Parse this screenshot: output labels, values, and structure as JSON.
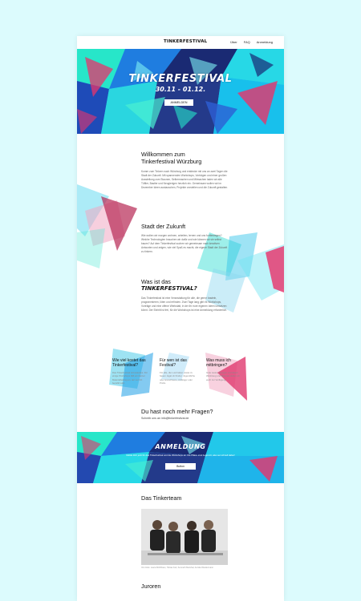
{
  "header": {
    "logo": "TINKERFESTIVAL",
    "nav": [
      "Über",
      "FAQ",
      "Anmeldung"
    ]
  },
  "hero": {
    "title": "TINKERFESTIVAL",
    "date": "30.11 - 01.12.",
    "button": "ANMELDEN"
  },
  "sections": {
    "welcome": {
      "title_line1": "Willkommen zum",
      "title_line2": "Tinkerfestival Würzburg",
      "text": "Komm zum Tinkern nach Würzburg und entdecke mit uns an zwei Tagen die Stadt der Zukunft. Mit spannenden Workshops, Vorträgen und einer großen Ausstellung zum Staunen, Selbermachen und Mitmachen laden wir alle Tüftler, Bastler und Neugierigen herzlich ein. Gemeinsam wollen wir im Dezember Ideen austauschen, Projekte vorstellen und die Zukunft gestalten."
    },
    "city": {
      "title": "Stadt der Zukunft",
      "text": "Wie wollen wir morgen wohnen, arbeiten, lernen und uns fortbewegen? Welche Technologien brauchen wir dafür und wie können wir sie selbst bauen? Auf dem Tinkerfestival suchen wir gemeinsam nach kreativen Antworten und zeigen, wie viel Spaß es macht, die eigene Stadt der Zukunft zu tinkern."
    },
    "what": {
      "title_line1": "Was ist das",
      "title_line2": "TINKERFESTIVAL?",
      "text": "Das Tinkerfestival ist eine Veranstaltung für alle, die gerne basteln, programmieren, löten und erfinden. Zwei Tage lang gibt es Workshops, Vorträge und eine offene Werkstatt, in der ihr eure eigenen Ideen umsetzen könnt. Der Eintritt ist frei, für die Workshops ist eine Anmeldung erforderlich."
    },
    "columns": [
      {
        "title": "Wie viel kostet das Tinkerfestival?",
        "text": "Das Tinkerfestival ist kostenlos. Für einige Workshops fällt ein kleiner Materialbeitrag an, der vor Ort bezahlt wird."
      },
      {
        "title": "Für wen ist das Festival?",
        "text": "Für alle, die Lust haben etwas zu bauen. Egal ob Kinder, Jugendliche oder Erwachsene, Anfänger oder Profis."
      },
      {
        "title": "Was muss ich mitbringen?",
        "text": "Gute Laune, Neugier und Ideen! Werkzeug und Material stellen wir euch zur Verfügung."
      }
    ],
    "questions": {
      "title": "Du hast noch mehr Fragen?",
      "text": "Schreib uns an info@tinkerfestival.de"
    }
  },
  "registration": {
    "title": "ANMELDUNG",
    "text": "Melde dich jetzt für das Tinkerfestival und die Workshops an. Die Plätze sind begrenzt, also sei schnell dabei!",
    "button": "Button"
  },
  "team": {
    "title": "Das Tinkerteam",
    "caption": "Von links: Laura Mühlhaus, Tobias Keil, Kenneth Marshal, Annika Wiedermann"
  },
  "jurors": {
    "title": "Juroren"
  },
  "colors": {
    "background": "#dcfbfd",
    "teal": "#22e0c4",
    "cyan": "#19c6f5",
    "blue": "#1f6fe0",
    "navy": "#1a2a73",
    "pink": "#e8336b"
  }
}
